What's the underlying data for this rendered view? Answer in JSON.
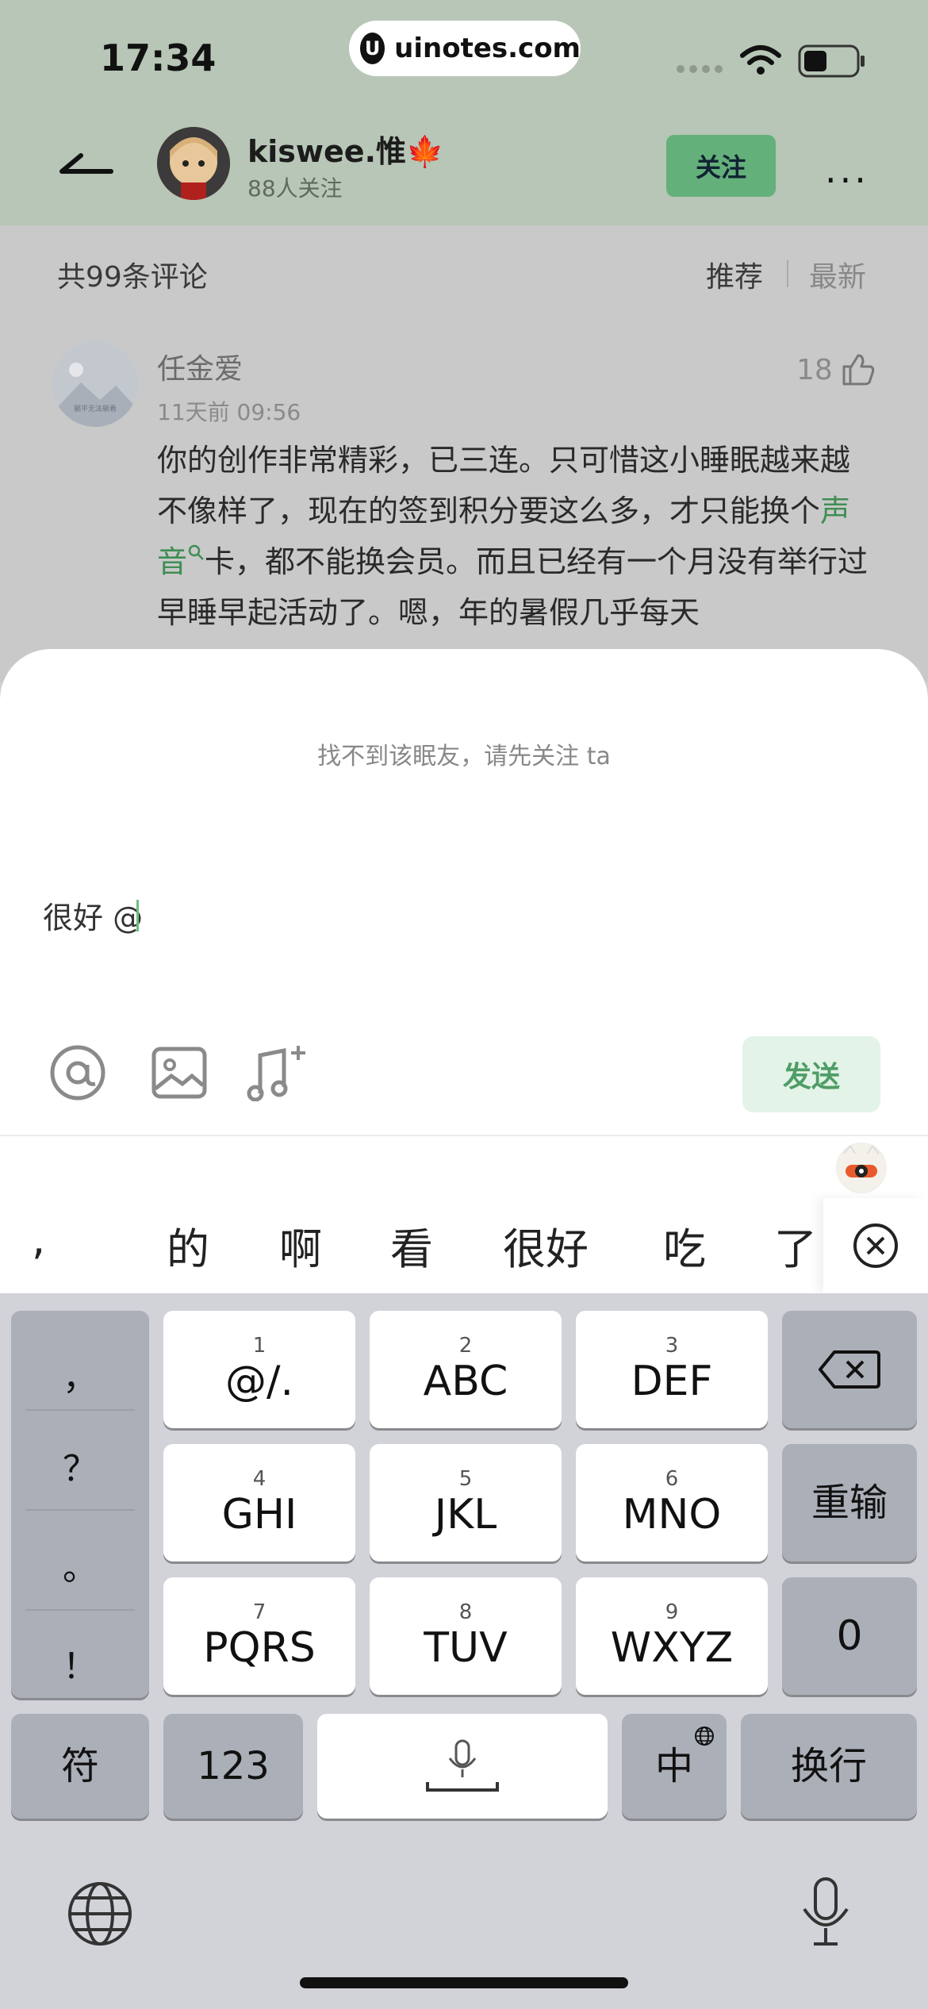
{
  "status_bar": {
    "time": "17:34",
    "url": "uinotes.com"
  },
  "header": {
    "nickname": "kiswee.惟🍁",
    "followers": "88人关注",
    "follow_label": "关注"
  },
  "comments": {
    "count_label": "共99条评论",
    "sort_options": [
      "推荐",
      "最新"
    ],
    "items": [
      {
        "avatar_caption": "躺平无法躺看",
        "name": "任金爱",
        "time": "11天前 09:56",
        "likes": "18",
        "text_before": "你的创作非常精彩，已三连。只可惜这小睡眠越来越不像样了，现在的签到积分要这么多，才只能换个",
        "link_text": "声音",
        "text_after": "卡，都不能换会员。而且已经有一个月没有举行过早睡早起活动了。嗯，年的暑假几乎每天"
      }
    ]
  },
  "sheet": {
    "hint": "找不到该眠友，请先关注 ta",
    "input_value": "很好 @",
    "send_label": "发送",
    "tools": [
      "at-icon",
      "image-icon",
      "music-add-icon"
    ]
  },
  "candidates": [
    ",",
    "的",
    "啊",
    "看",
    "很好",
    "吃",
    "了"
  ],
  "keyboard": {
    "punct": [
      "，",
      "？",
      "。",
      "！"
    ],
    "keys": [
      {
        "num": "1",
        "label": "@/."
      },
      {
        "num": "2",
        "label": "ABC"
      },
      {
        "num": "3",
        "label": "DEF"
      },
      {
        "num": "4",
        "label": "GHI"
      },
      {
        "num": "5",
        "label": "JKL"
      },
      {
        "num": "6",
        "label": "MNO"
      },
      {
        "num": "7",
        "label": "PQRS"
      },
      {
        "num": "8",
        "label": "TUV"
      },
      {
        "num": "9",
        "label": "WXYZ"
      }
    ],
    "reenter": "重输",
    "zero": "0",
    "symbols": "符",
    "numbers": "123",
    "lang": "中",
    "return": "换行"
  }
}
